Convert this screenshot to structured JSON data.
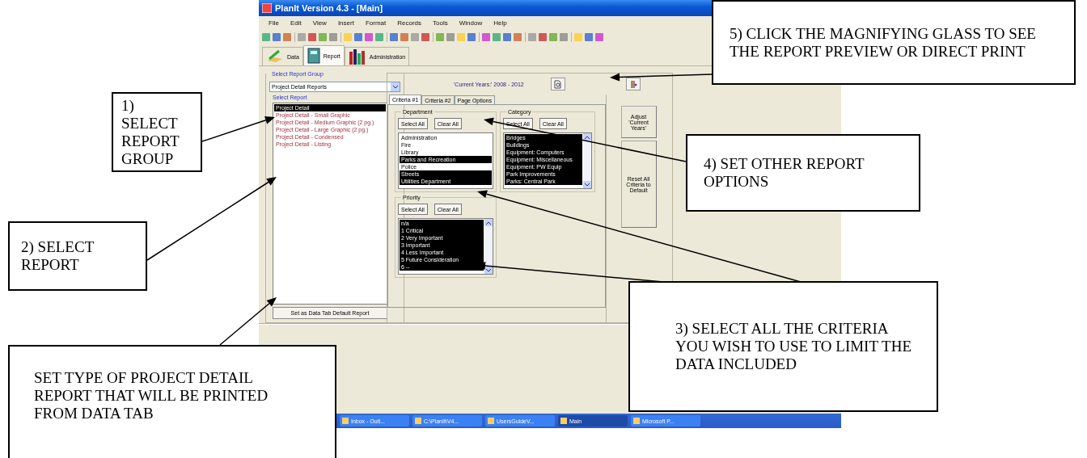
{
  "window": {
    "title": "PlanIt Version 4.3 - [Main]"
  },
  "menu": [
    "File",
    "Edit",
    "View",
    "Insert",
    "Format",
    "Records",
    "Tools",
    "Window",
    "Help"
  ],
  "module_tabs": [
    {
      "label": "Data",
      "selected": false
    },
    {
      "label": "Report",
      "selected": true
    },
    {
      "label": "Administration",
      "selected": false
    }
  ],
  "current_years": "'Current Years:' 2008 - 2012",
  "report_group": {
    "label": "Select Report Group",
    "value": "Project Detail Reports"
  },
  "report_list": {
    "label": "Select Report",
    "items": [
      {
        "label": "Project Detail",
        "selected": true
      },
      {
        "label": "Project Detail - Small Graphic",
        "selected": false
      },
      {
        "label": "Project Detail - Medium Graphic (2 pg.)",
        "selected": false
      },
      {
        "label": "Project Detail - Large Graphic (2 pg.)",
        "selected": false
      },
      {
        "label": "Project Detail - Condensed",
        "selected": false
      },
      {
        "label": "Project Detail - Listing",
        "selected": false
      }
    ]
  },
  "default_button": "Set as Data Tab Default Report",
  "criteria_tabs": [
    {
      "label": "Criteria #1",
      "selected": true
    },
    {
      "label": "Criteria #2",
      "selected": false
    },
    {
      "label": "Page Options",
      "selected": false
    }
  ],
  "criteria_groups": [
    {
      "title": "Department",
      "select_all": "Select All",
      "clear_all": "Clear All",
      "items": [
        {
          "label": "Administration",
          "selected": false
        },
        {
          "label": "Fire",
          "selected": false
        },
        {
          "label": "Library",
          "selected": false
        },
        {
          "label": "Parks and Recreation",
          "selected": true
        },
        {
          "label": "Police",
          "selected": false
        },
        {
          "label": "Streets",
          "selected": true
        },
        {
          "label": "Utilities Department",
          "selected": true
        }
      ]
    },
    {
      "title": "Category",
      "select_all": "Select All",
      "clear_all": "Clear All",
      "items": [
        {
          "label": "Bridges",
          "selected": true
        },
        {
          "label": "Buildings",
          "selected": true
        },
        {
          "label": "Equipment: Computers",
          "selected": true
        },
        {
          "label": "Equipment: Miscellaneous",
          "selected": true
        },
        {
          "label": "Equipment: PW Equip",
          "selected": true
        },
        {
          "label": "Park Improvements",
          "selected": true
        },
        {
          "label": "Parks: Central Park",
          "selected": true
        }
      ]
    },
    {
      "title": "Priority",
      "select_all": "Select All",
      "clear_all": "Clear All",
      "items": [
        {
          "label": "n/a",
          "selected": true
        },
        {
          "label": "1 Critical",
          "selected": true
        },
        {
          "label": "2 Very Important",
          "selected": true
        },
        {
          "label": "3 Important",
          "selected": true
        },
        {
          "label": "4 Less Important",
          "selected": true
        },
        {
          "label": "5 Future Consideration",
          "selected": true
        },
        {
          "label": "6 --",
          "selected": true
        }
      ]
    }
  ],
  "side_buttons": [
    "Adjust 'Current Years'",
    "Reset All Criteria to Default"
  ],
  "taskbar": [
    "Inbox - Outl...",
    "C:\\PlanIt\\V4...",
    "UsersGuideV...",
    "Main",
    "Microsoft P..."
  ],
  "callouts": [
    {
      "text": "1) SELECT REPORT GROUP"
    },
    {
      "text": "2) SELECT REPORT"
    },
    {
      "text": "SET TYPE OF PROJECT DETAIL REPORT THAT WILL BE PRINTED FROM DATA TAB"
    },
    {
      "text": "5) CLICK THE MAGNIFYING GLASS TO SEE THE REPORT PREVIEW OR DIRECT PRINT"
    },
    {
      "text": "4) SET OTHER REPORT OPTIONS"
    },
    {
      "text": "3) SELECT ALL THE CRITERIA YOU WISH TO USE TO LIMIT THE DATA INCLUDED"
    }
  ]
}
